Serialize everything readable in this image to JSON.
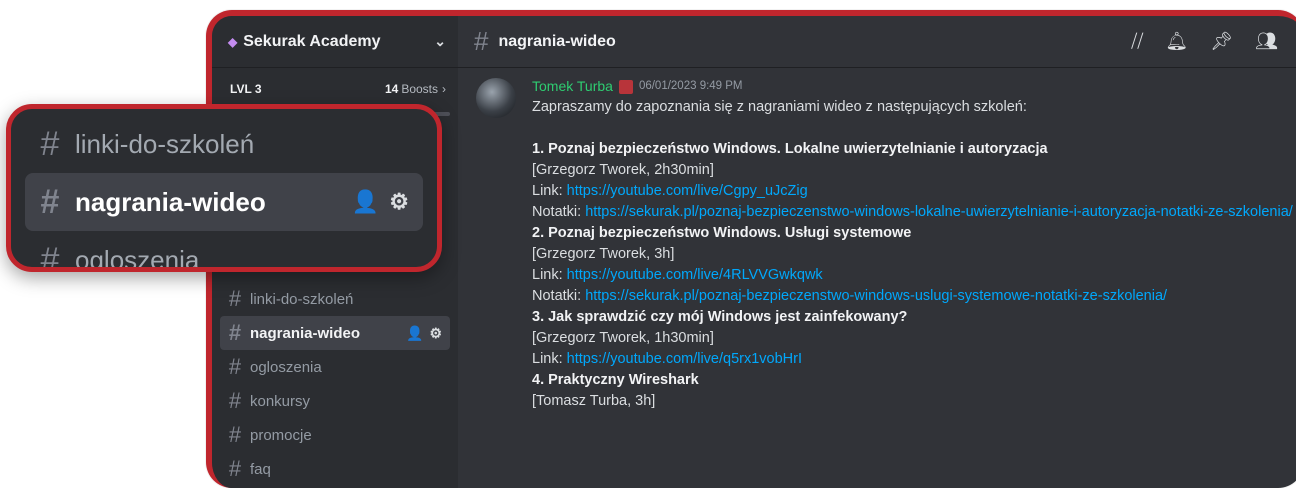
{
  "server": {
    "name": "Sekurak Academy",
    "level": "LVL 3",
    "boost_count": "14",
    "boost_word": "Boosts",
    "boost_progress": 0.92
  },
  "sidebar": {
    "channels": [
      {
        "label": "linki-do-szkoleń"
      },
      {
        "label": "nagrania-wideo"
      },
      {
        "label": "ogloszenia"
      },
      {
        "label": "konkursy"
      },
      {
        "label": "promocje"
      },
      {
        "label": "faq"
      }
    ]
  },
  "callout": {
    "channels": [
      {
        "label": "linki-do-szkoleń"
      },
      {
        "label": "nagrania-wideo"
      },
      {
        "label": "ogloszenia"
      }
    ]
  },
  "topbar": {
    "channel_title": "nagrania-wideo"
  },
  "message": {
    "author": "Tomek Turba",
    "timestamp": "06/01/2023 9:49 PM",
    "intro": "Zapraszamy do zapoznania się z nagraniami wideo z następujących szkoleń:",
    "items": [
      {
        "title": "1. Poznaj bezpieczeństwo Windows. Lokalne uwierzytelnianie i autoryzacja",
        "meta": " [Grzegorz Tworek, 2h30min]",
        "link_label": "Link: ",
        "link": "https://youtube.com/live/Cgpy_uJcZig",
        "notes_label": "Notatki: ",
        "notes": "https://sekurak.pl/poznaj-bezpieczenstwo-windows-lokalne-uwierzytelnianie-i-autoryzacja-notatki-ze-szkolenia/"
      },
      {
        "title": "2. Poznaj bezpieczeństwo Windows. Usługi systemowe",
        "meta": "[Grzegorz Tworek, 3h]",
        "link_label": "Link: ",
        "link": "https://youtube.com/live/4RLVVGwkqwk",
        "notes_label": "Notatki: ",
        "notes": "https://sekurak.pl/poznaj-bezpieczenstwo-windows-uslugi-systemowe-notatki-ze-szkolenia/"
      },
      {
        "title": "3. Jak sprawdzić czy mój Windows jest zainfekowany?",
        "meta": "[Grzegorz Tworek, 1h30min]",
        "link_label": "Link: ",
        "link": "https://youtube.com/live/q5rx1vobHrI"
      },
      {
        "title": "4. Praktyczny Wireshark",
        "meta": "[Tomasz Turba, 3h]"
      }
    ]
  },
  "icons": {
    "threads": "threads-icon",
    "bell": "bell-icon",
    "pin": "pin-icon",
    "members": "members-icon"
  },
  "colors": {
    "accent_frame": "#c0262d",
    "link": "#00a8fc",
    "author": "#2ecc71"
  }
}
